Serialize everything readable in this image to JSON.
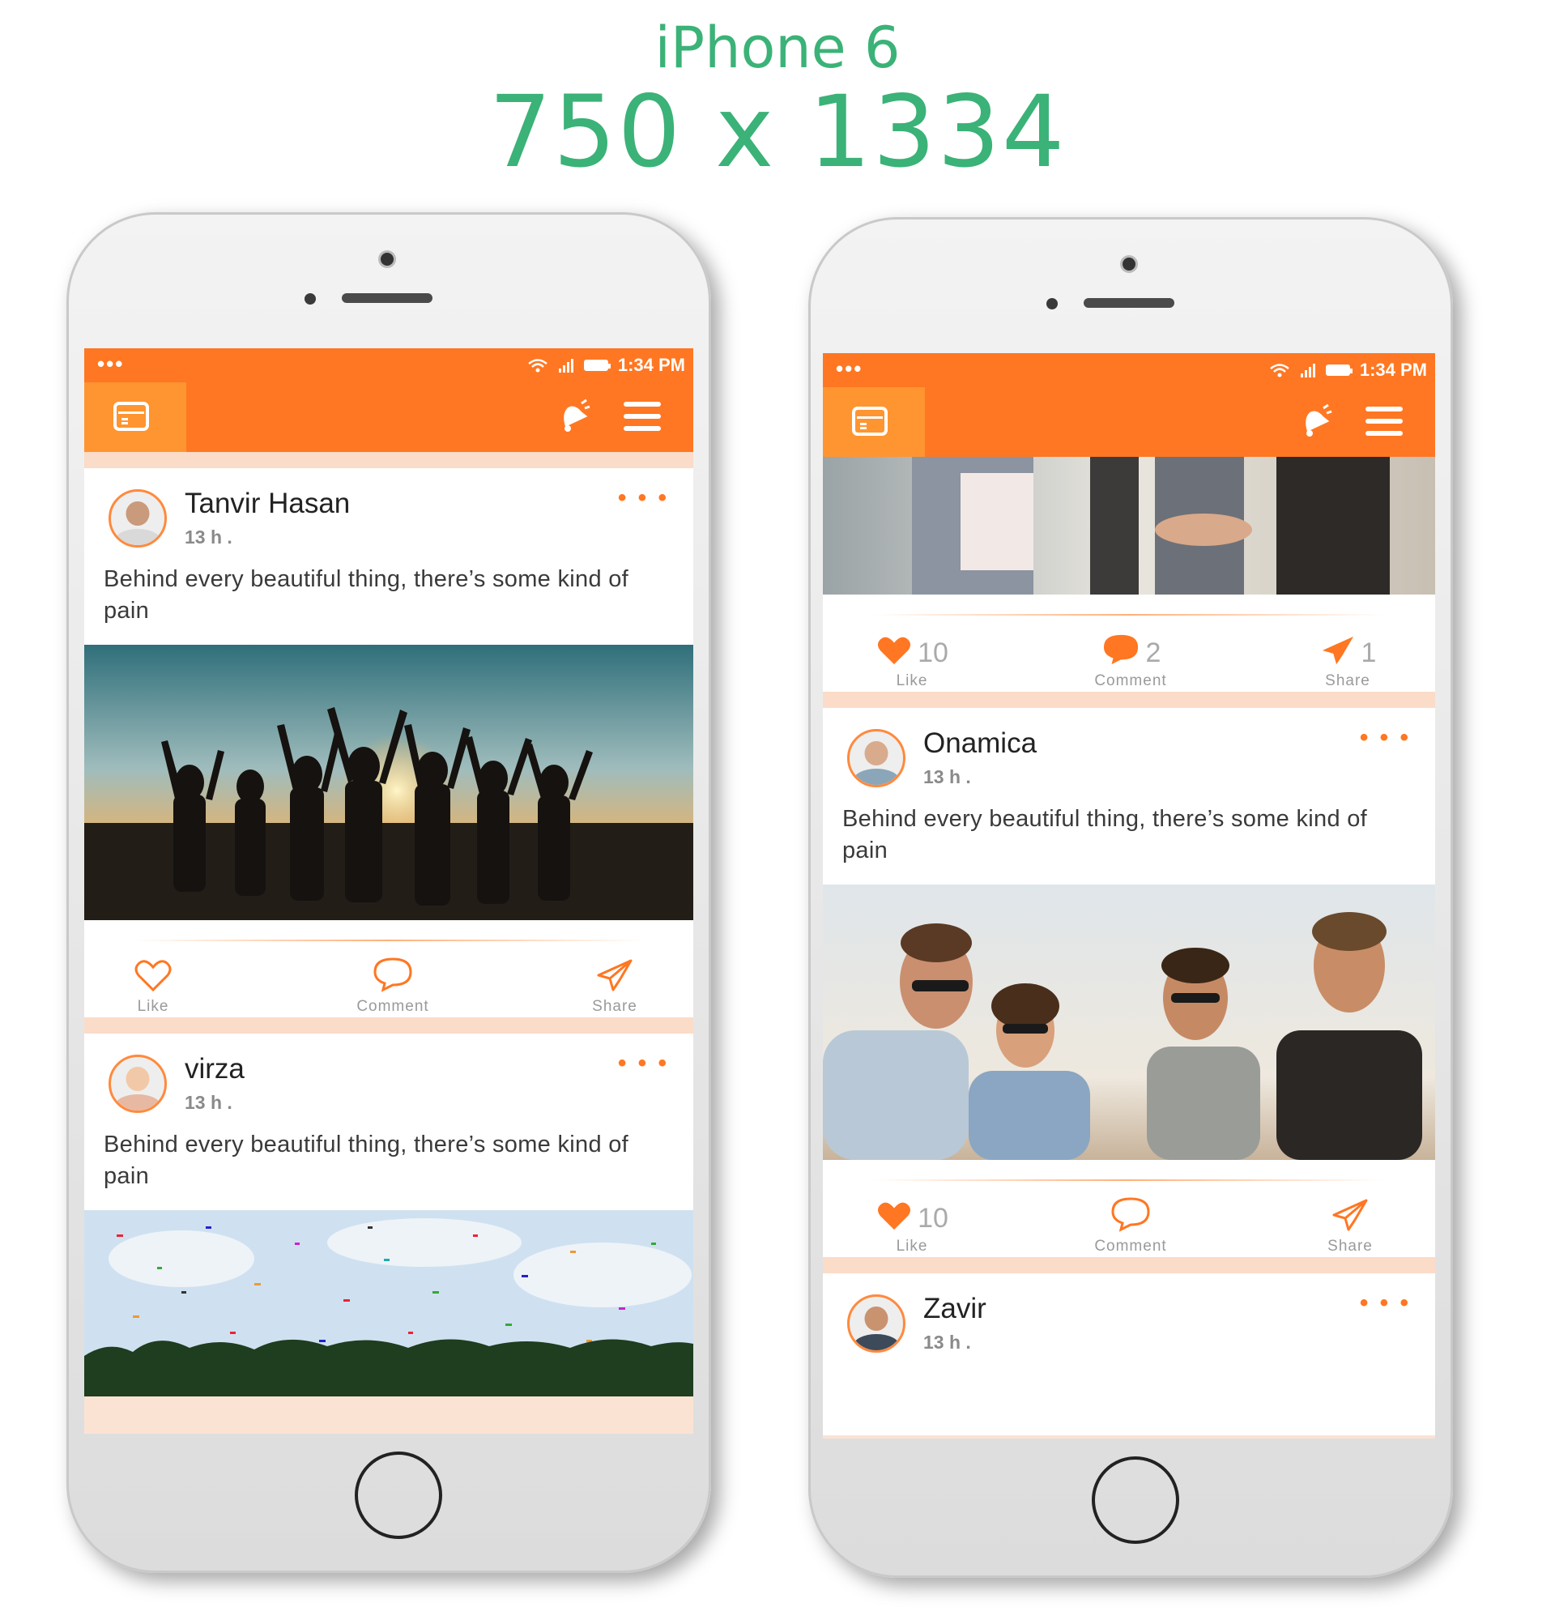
{
  "header": {
    "model": "iPhone 6",
    "resolution": "750 x 1334"
  },
  "status_bar": {
    "time": "1:34 PM",
    "dots": "•••"
  },
  "more_glyph": "• • •",
  "actions": {
    "like": "Like",
    "comment": "Comment",
    "share": "Share"
  },
  "left_phone": {
    "posts": [
      {
        "author": "Tanvir Hasan",
        "time": "13 h .",
        "text": "Behind every beautiful thing, there’s some kind of pain"
      },
      {
        "author": "virza",
        "time": "13 h .",
        "text": "Behind every beautiful thing, there’s some kind of pain"
      }
    ]
  },
  "right_phone": {
    "top_counts": {
      "likes": "10",
      "comments": "2",
      "shares": "1"
    },
    "posts": [
      {
        "author": "Onamica",
        "time": "13 h .",
        "text": "Behind every beautiful thing, there’s some kind of pain",
        "likes": "10"
      },
      {
        "author": "Zavir",
        "time": "13 h ."
      }
    ]
  },
  "colors": {
    "accent": "#ff7722",
    "title_green": "#3bb277",
    "divider": "#fbdcc8"
  }
}
